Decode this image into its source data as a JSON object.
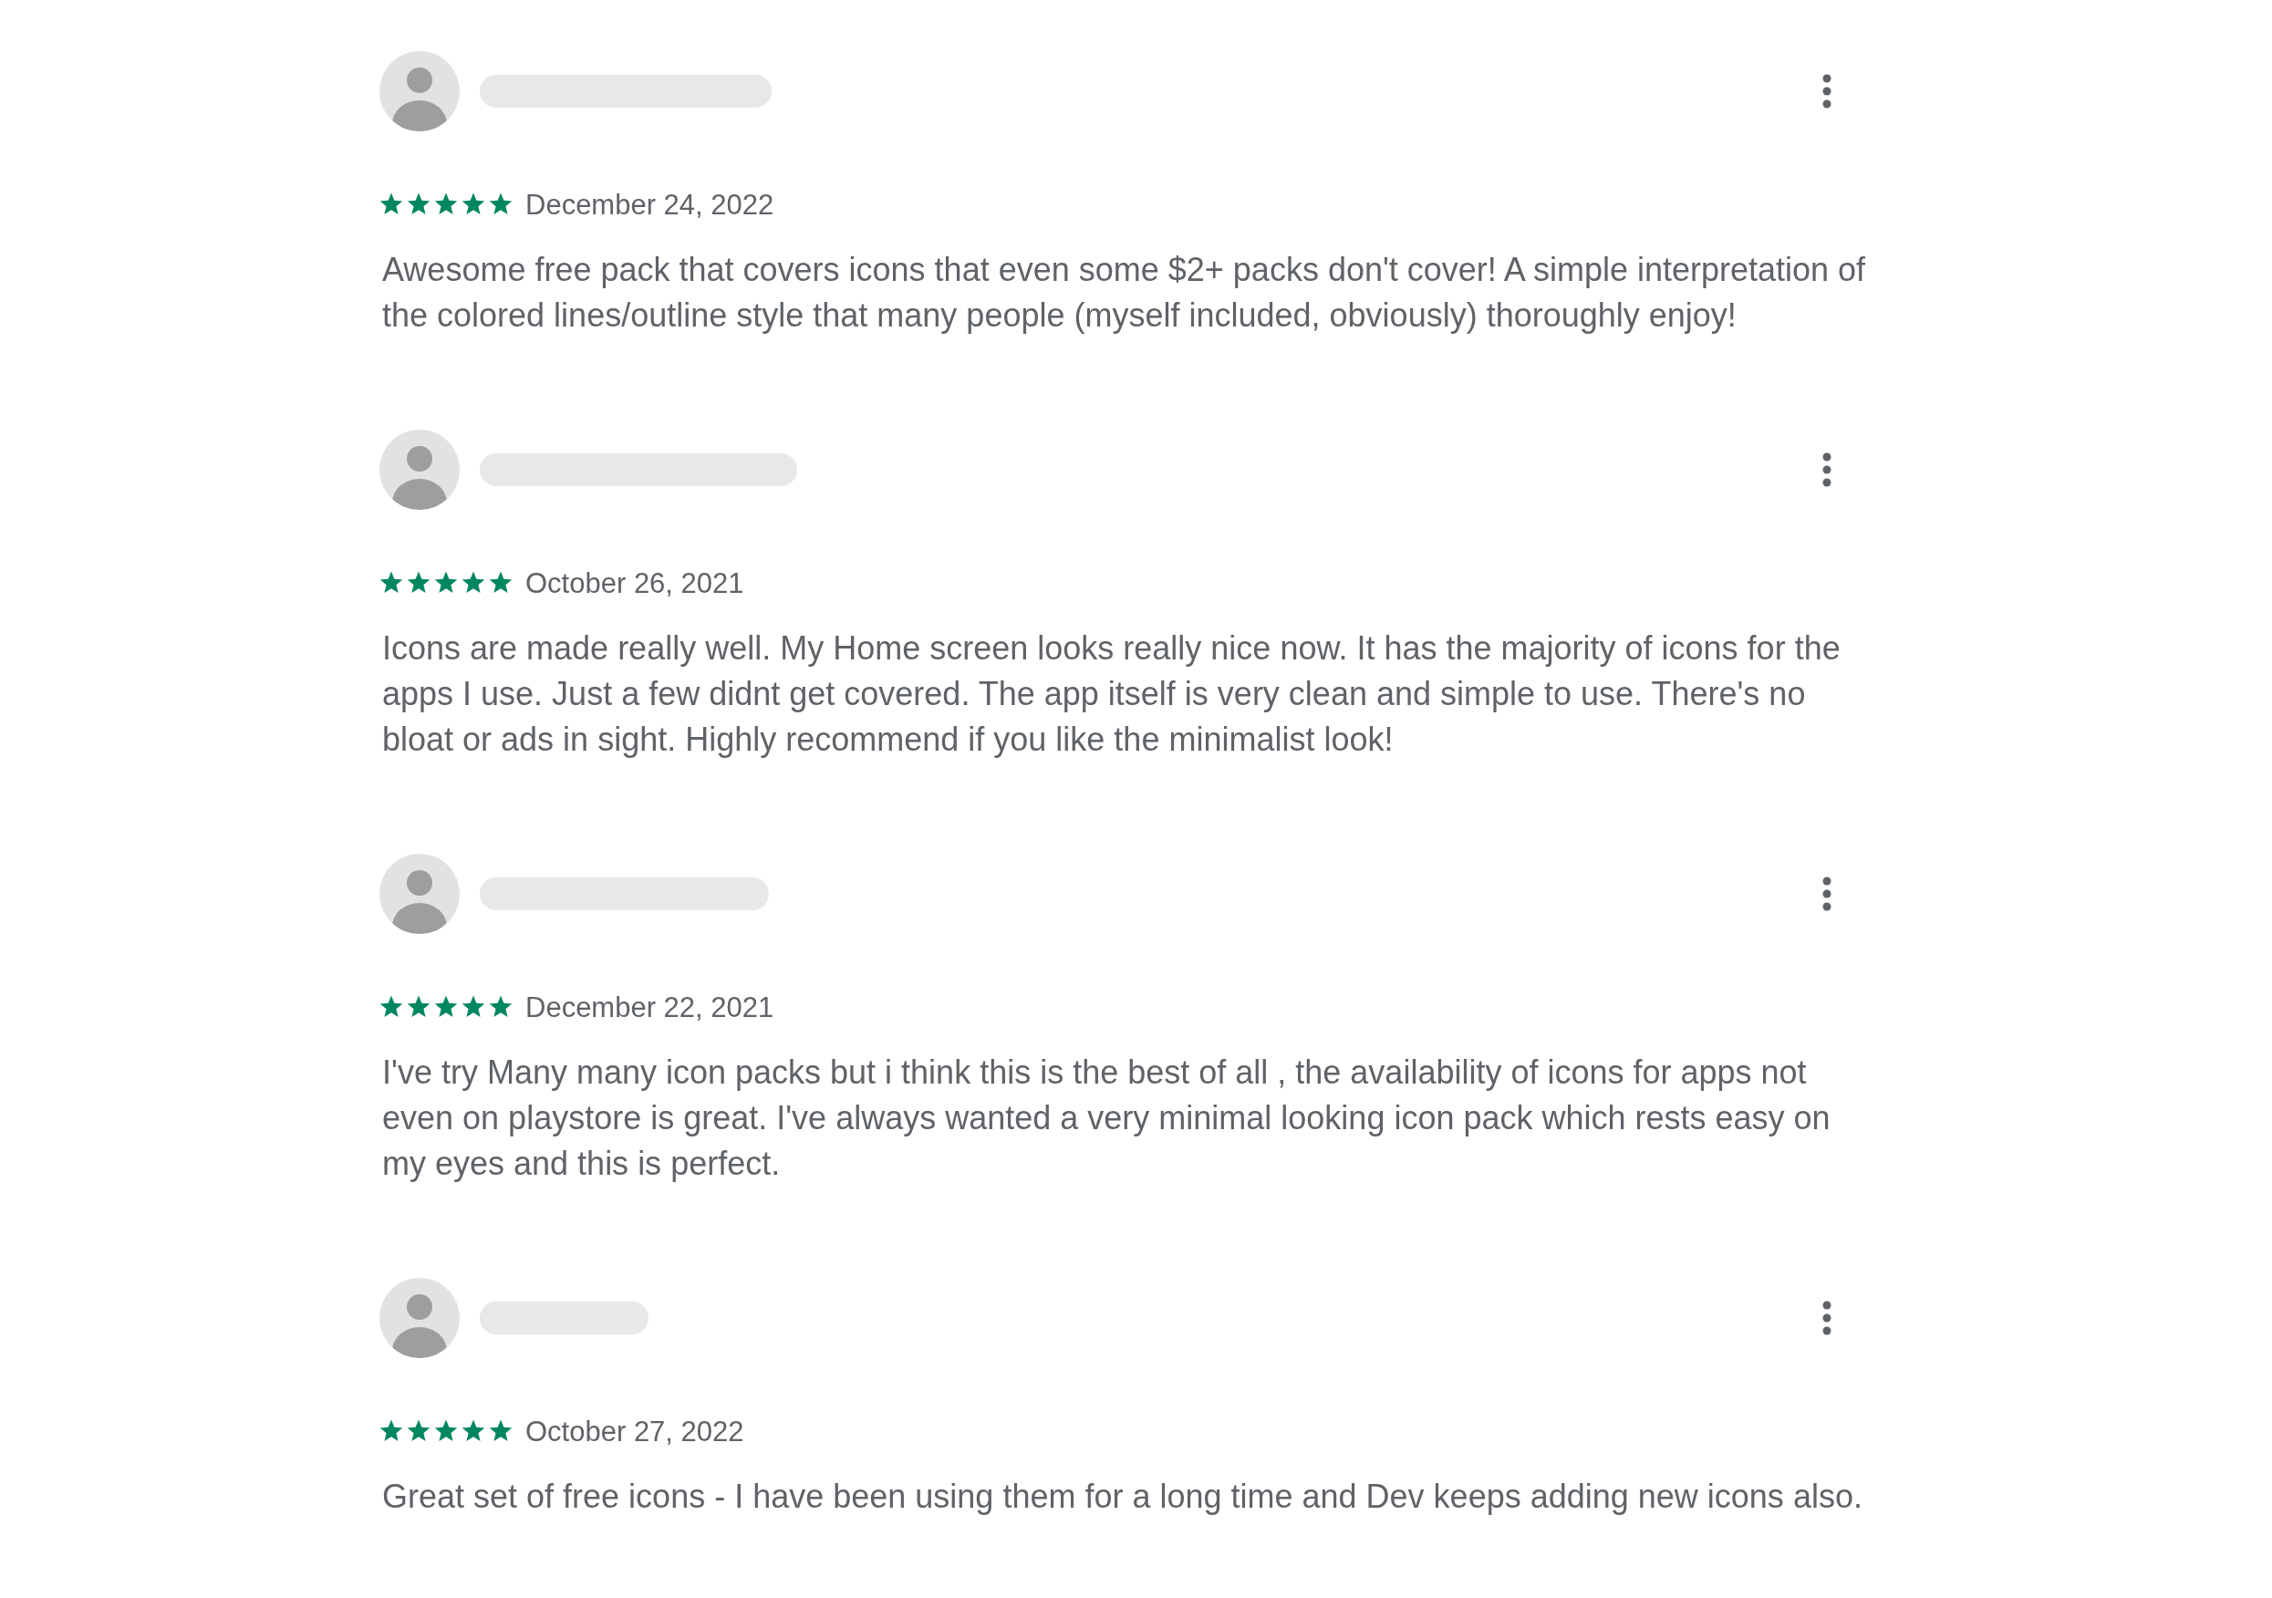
{
  "reviews": [
    {
      "stars": 5,
      "date": "December 24, 2022",
      "text": "Awesome free pack that covers icons that even some $2+ packs don't cover! A simple interpretation of the colored lines/outline style that many people (myself included, obviously) thoroughly enjoy!"
    },
    {
      "stars": 5,
      "date": "October 26, 2021",
      "text": "Icons are made really well. My Home screen looks really nice now. It has the majority of icons for the apps I use. Just a few didnt get covered. The app itself is very clean and simple to use. There's no bloat or ads in sight. Highly recommend if you like the minimalist look!"
    },
    {
      "stars": 5,
      "date": "December 22, 2021",
      "text": "I've try Many many icon packs but i think this is the best of all , the availability of icons for apps not even on playstore is great. I've always wanted a very minimal looking icon pack which rests easy on my eyes and this is perfect."
    },
    {
      "stars": 5,
      "date": "October 27, 2022",
      "text": "Great set of free icons - I have been using them for a long time and Dev keeps adding new icons also."
    }
  ]
}
